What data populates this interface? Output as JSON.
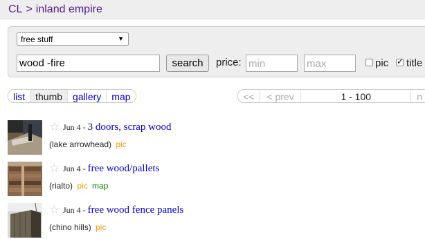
{
  "breadcrumb": {
    "site": "CL",
    "separator": ">",
    "region": "inland empire"
  },
  "search": {
    "category": "free stuff",
    "query": "wood -fire",
    "button": "search",
    "price_label": "price:",
    "min_placeholder": "min",
    "max_placeholder": "max",
    "pic_label": "pic",
    "pic_checked": false,
    "title_label": "title",
    "title_checked": true
  },
  "view_tabs": [
    {
      "label": "list",
      "active": false
    },
    {
      "label": "thumb",
      "active": true
    },
    {
      "label": "gallery",
      "active": false
    },
    {
      "label": "map",
      "active": false
    }
  ],
  "pager": {
    "first": "<<",
    "prev": "< prev",
    "range": "1 - 100",
    "next": "n"
  },
  "listings": [
    {
      "date": "Jun 4",
      "title": "3 doors, scrap wood",
      "location": "(lake arrowhead)",
      "pic": "pic",
      "map": ""
    },
    {
      "date": "Jun 4",
      "title": "free wood/pallets",
      "location": "(rialto)",
      "pic": "pic",
      "map": "map"
    },
    {
      "date": "Jun 4",
      "title": "free wood fence panels",
      "location": "(chino hills)",
      "pic": "pic",
      "map": ""
    }
  ],
  "icons": {
    "star": "star-icon",
    "dropdown": "chevron-down-icon",
    "check": "check-icon"
  }
}
